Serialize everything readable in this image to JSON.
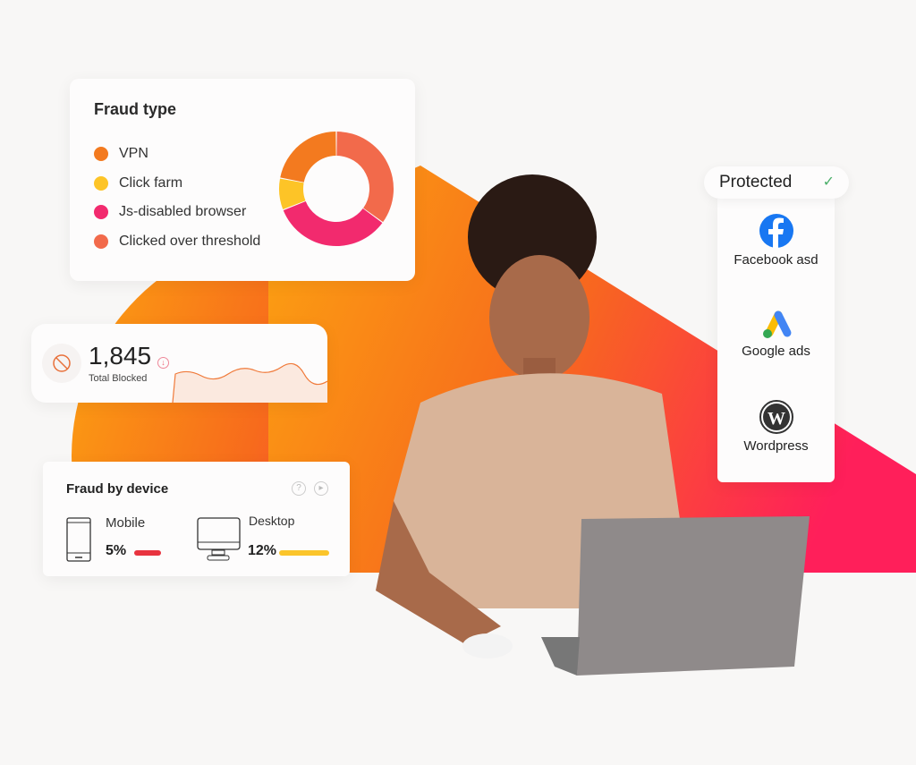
{
  "fraud_type": {
    "title": "Fraud type",
    "items": [
      {
        "label": "VPN",
        "color": "#f37a1f",
        "share": 22
      },
      {
        "label": "Click farm",
        "color": "#fdc427",
        "share": 9
      },
      {
        "label": "Js-disabled browser",
        "color": "#f22a6e",
        "share": 34
      },
      {
        "label": "Clicked over threshold",
        "color": "#f26a4b",
        "share": 35
      }
    ]
  },
  "total_blocked": {
    "value": "1,845",
    "label": "Total Blocked",
    "icon": "ban-icon",
    "trend_icon": "arrow-down-icon"
  },
  "fraud_by_device": {
    "title": "Fraud by device",
    "help_icon": "question-icon",
    "play_icon": "play-icon",
    "devices": [
      {
        "label": "Mobile",
        "percent": "5%",
        "color": "#e8333f",
        "icon": "mobile-icon"
      },
      {
        "label": "Desktop",
        "percent": "12%",
        "color": "#fbc52b",
        "icon": "desktop-icon"
      }
    ]
  },
  "protected": {
    "label": "Protected",
    "check_icon": "check-icon",
    "platforms": [
      {
        "label": "Facebook asd",
        "icon": "facebook-icon"
      },
      {
        "label": "Google ads",
        "icon": "google-ads-icon"
      },
      {
        "label": "Wordpress",
        "icon": "wordpress-icon"
      }
    ]
  },
  "colors": {
    "gradient_start": "#fca311",
    "gradient_mid": "#f76b1c",
    "gradient_end": "#ff1f5a"
  }
}
